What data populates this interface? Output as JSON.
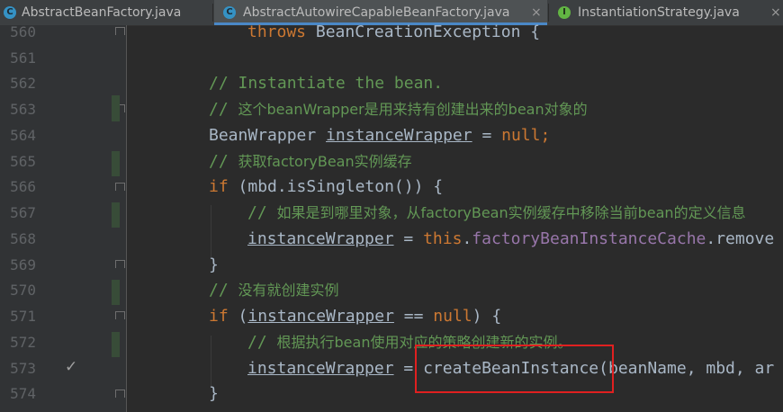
{
  "tabs": [
    {
      "icon": "C",
      "label": "AbstractBeanFactory.java",
      "active": false
    },
    {
      "icon": "C",
      "label": "AbstractAutowireCapableBeanFactory.java",
      "active": true,
      "close": "×"
    },
    {
      "icon": "I",
      "label": "InstantiationStrategy.java",
      "active": false,
      "close": "×"
    }
  ],
  "line_numbers": [
    "560",
    "561",
    "562",
    "563",
    "564",
    "565",
    "566",
    "567",
    "568",
    "569",
    "570",
    "571",
    "572",
    "573",
    "574"
  ],
  "code": {
    "l560": {
      "kw": "throws",
      "rest": " BeanCreationException {"
    },
    "l562": {
      "comment": "// Instantiate the bean."
    },
    "l563": {
      "comment_prefix": "// ",
      "comment_text": "这个beanWrapper是用来持有创建出来的bean对象的"
    },
    "l564": {
      "type": "BeanWrapper ",
      "var": "instanceWrapper",
      "op": " = ",
      "kw": "null",
      "end": ";"
    },
    "l565": {
      "comment_prefix": "// ",
      "comment_text": "获取factoryBean实例缓存"
    },
    "l566": {
      "kw": "if",
      "rest": " (mbd.isSingleton()) {"
    },
    "l567": {
      "comment_prefix": "// ",
      "comment_text": "如果是到哪里对象，从factoryBean实例缓存中移除当前bean的定义信息"
    },
    "l568": {
      "var": "instanceWrapper",
      "op": " = ",
      "kw": "this",
      "dot": ".",
      "field": "factoryBeanInstanceCache",
      "rest": ".remove"
    },
    "l569": {
      "text": "}"
    },
    "l570": {
      "comment_prefix": "// ",
      "comment_text": "没有就创建实例"
    },
    "l571": {
      "kw": "if",
      "open": " (",
      "var": "instanceWrapper",
      "op": " == ",
      "kw2": "null",
      "rest": ") {"
    },
    "l572": {
      "comment_prefix": "// ",
      "comment_text": "根据执行bean使用对应的策略创建新的实例。"
    },
    "l573": {
      "var": "instanceWrapper",
      "op": " = ",
      "call": "createBeanInstance",
      "rest": "(beanName, mbd, ar"
    },
    "l574": {
      "text": "}"
    }
  },
  "gutter": {
    "check_icon": "✓"
  },
  "colors": {
    "keyword": "#cc7832",
    "comment": "#629755",
    "field": "#9876aa",
    "text": "#a9b7c6",
    "highlight_box": "#e02020"
  }
}
